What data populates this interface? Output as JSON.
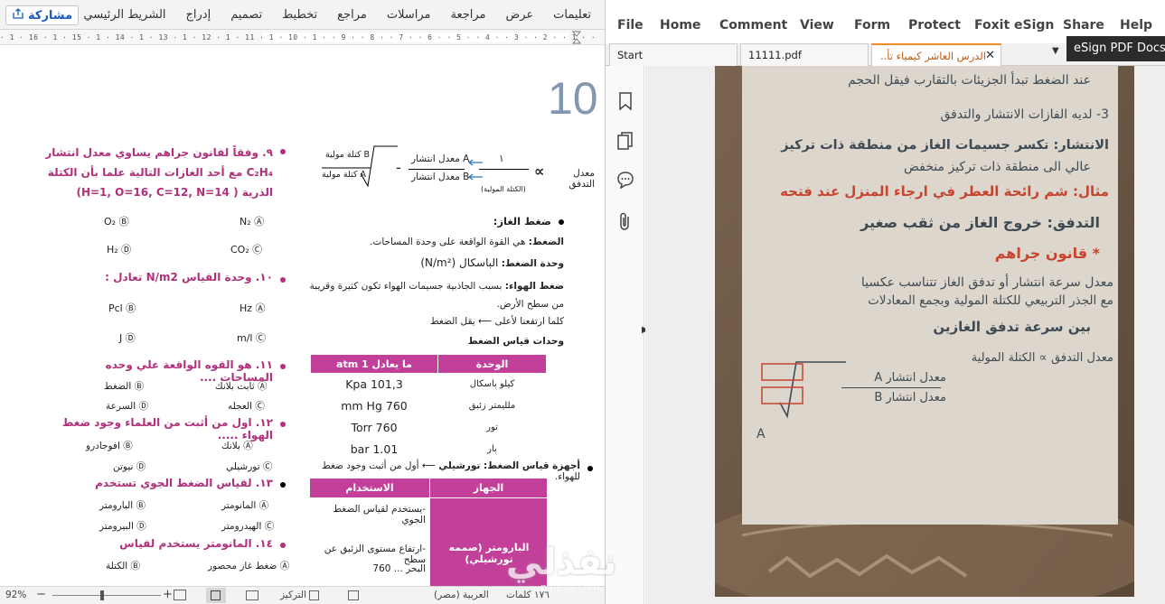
{
  "word": {
    "share_label": "مشاركة",
    "ribbon_tabs": [
      "الشريط الرئيسي",
      "إدراج",
      "تصميم",
      "تخطيط",
      "مراجع",
      "مراسلات",
      "مراجعة",
      "عرض",
      "تعليمات"
    ],
    "ruler_text": "· 1 · 16 · 1 · 15 · 1 · 14 · 1 · 13 · 1 · 12 · 1 · 11 · 1 · 10 · 1 ·   · 9 · · 8 · · 7 · · 6 · · 5 · · 4 · · 3 · · 2 · · 1 · · ",
    "page_number": "10",
    "right_col": {
      "flow_label": "معدل التدفق",
      "proportional": "∝",
      "one": "١",
      "molar_mass_label": "(الكتلة المولية)",
      "rate_a": "معدل انتشار A",
      "rate_b": "معدل انتشار B",
      "mass_a": "كتلة مولية B",
      "mass_b": "كتلة مولية A",
      "gas_pressure_heading": "ضغط الغاز:",
      "pressure_def_label": "الضغط:",
      "pressure_def": "هي القوة الواقعة على وحدة المساحات.",
      "pressure_unit_label": "وحدة الضغط:",
      "pressure_unit": "الباسكال (N/m²)",
      "air_pressure_label": "ضغط الهواء:",
      "air_pressure": "بسبب الجاذبية جسيمات الهواء تكون كثيرة وقريبة من سطح الأرض.",
      "altitude_note": "كلما ارتفعنا لأعلى ⟵ يقل الضغط",
      "units_heading": "وحدات قياس الضغط",
      "units_table": {
        "headers": [
          "الوحدة",
          "ما يعادل 1 atm"
        ],
        "rows": [
          [
            "كيلو باسكال",
            "101,3 Kpa"
          ],
          [
            "ملليمتر زئبق",
            "760 mm Hg"
          ],
          [
            "تور",
            "760 Torr"
          ],
          [
            "بار",
            "1.01 bar"
          ]
        ]
      },
      "devices_label": "أجهزة قياس الضغط: تورشيلي",
      "devices_note": "⟵ أول من أثبت وجود ضغط للهواء.",
      "devices_table": {
        "headers": [
          "الجهاز",
          "الاستخدام"
        ],
        "device": "البارومتر (صممه تورشيلي)",
        "uses": [
          "-يستخدم لقياس الضغط الجوي",
          "-ارتفاع مستوى الزئبق عن سطح",
          "البحر ...  760"
        ]
      }
    },
    "left_col": {
      "q9": "٩. وفقاً لقانون جراهم يساوي معدل انتشار C₂H₄ مع أحد الغازات التالية علما بأن الكتلة الذرية ( H=1, O=16, C=12, N=14)",
      "q9_options": [
        "N₂ Ⓐ",
        "O₂ Ⓑ",
        "CO₂ Ⓒ",
        "H₂ Ⓓ"
      ],
      "q10": "١٠. وحدة القياس N/m2 تعادل :",
      "q10_options": [
        "Hz Ⓐ",
        "Pcl Ⓑ",
        "m/l Ⓒ",
        "J Ⓓ"
      ],
      "q11": "١١. هو القوه الواقعة علي وحده المساحات ....",
      "q11_options": [
        "ثابت بلانك Ⓐ",
        "الضغط Ⓑ",
        "العجله Ⓒ",
        "السرعة Ⓓ"
      ],
      "q12": "١٢. اول من أثبت من العلماء وجود ضغط الهواء .....",
      "q12_options": [
        "بلانك Ⓐ",
        "افوجادرو Ⓑ",
        "تورشيلي Ⓒ",
        "نيوتن Ⓓ"
      ],
      "q13": "١٣. لقياس الضغط الجوي تستخدم",
      "q13_options": [
        "المانومتر Ⓐ",
        "البارومتر Ⓑ",
        "الهيدرومتر Ⓒ",
        "البيرومتر Ⓓ"
      ],
      "q14": "١٤. المانومتر يستخدم لقياس",
      "q14_options": [
        "ضغط غاز محصور Ⓐ",
        "الكتلة Ⓑ"
      ]
    },
    "status": {
      "zoom": "92%",
      "focus": "التركيز",
      "language": "العربية (مصر)",
      "words": "١٧٦ كلمات"
    }
  },
  "foxit": {
    "menu": [
      "File",
      "Home",
      "Comment",
      "View",
      "Form",
      "Protect",
      "Foxit eSign",
      "Share",
      "Help"
    ],
    "tabs": [
      "Start",
      "11111.pdf",
      "الدرس العاشر كيمياء تأ..."
    ],
    "esign_label": "eSign PDF Docs",
    "handwriting": [
      "3- لديه الفازات الانتشار والتدفق",
      "الانتشار: تكسر جسيمات الغاز من منطقة ذات تركيز",
      "عالي الى منطقة ذات تركيز منخفض",
      "مثال: شم رائحة العطر في ارجاء المنزل عند فتحه",
      "التدفق: خروج الغاز من ثقب صغير",
      "* قانون جراهم",
      "معدل سرعة انتشار أو تدفق الغاز تتناسب عكسيا",
      "مع الجذر التربيعي للكتلة المولية وبجمع المعادلات",
      "بين سرعة تدفق الغازين",
      "معدل التدفق ∝ الكتلة المولية",
      "معدل انتشار A",
      "معدل انتشار B",
      "عند الضغط تبدأ الجزيئات بالتقارب فيقل الحجم"
    ],
    "watermark": "نفذلي",
    "watermark_sub": "nafezly.com"
  }
}
